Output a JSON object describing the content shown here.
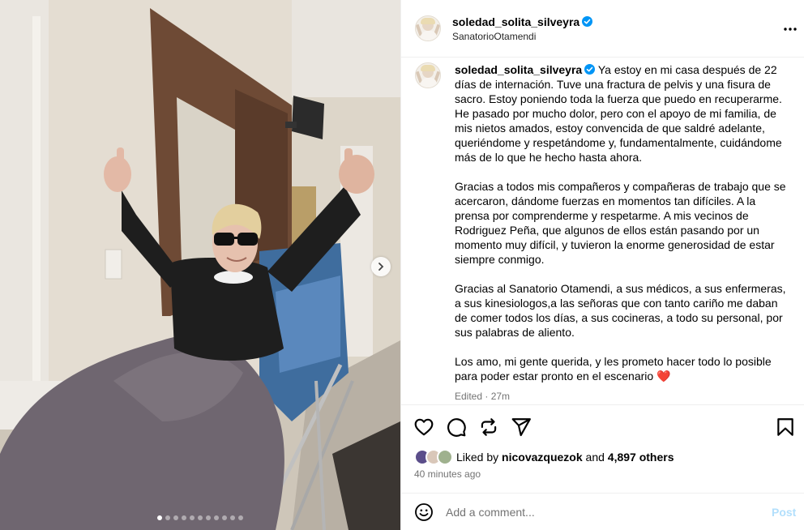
{
  "header": {
    "username": "soledad_solita_silveyra",
    "location": "SanatorioOtamendi",
    "more_icon": "more-horizontal-icon"
  },
  "caption": {
    "username": "soledad_solita_silveyra",
    "paragraphs": [
      "Ya estoy en mi casa después de 22 días de internación. Tuve una fractura de pelvis y una fisura de sacro. Estoy poniendo toda la fuerza que puedo en recuperarme. He pasado por mucho dolor, pero con el apoyo de mi familia, de mis nietos amados, estoy convencida de que saldré adelante, queriéndome y respetándome y, fundamentalmente, cuidándome más de lo que he hecho hasta ahora.",
      "Gracias a todos mis compañeros y compañeras de trabajo que se acercaron, dándome fuerzas en momentos tan difíciles. A la prensa por comprenderme y respetarme. A mis vecinos de Rodriguez Peña, que algunos de ellos están pasando por un momento muy difícil, y tuvieron la enorme generosidad de estar siempre conmigo.",
      "Gracias al Sanatorio Otamendi, a sus médicos, a sus enfermeras, a sus kinesiologos,a las señoras que con tanto cariño me daban de comer todos los días, a sus cocineras, a todo su personal, por sus palabras de aliento.",
      "Los amo, mi gente querida, y les prometo hacer todo lo posible para poder estar pronto en el escenario"
    ],
    "emoji": "❤️",
    "edited": "Edited · 27m"
  },
  "actions": {
    "like_icon": "heart-icon",
    "comment_icon": "comment-icon",
    "share_icon": "repost-icon",
    "send_icon": "send-icon",
    "save_icon": "bookmark-icon"
  },
  "likes": {
    "prefix": "Liked by",
    "user": "nicovazquezok",
    "and": "and",
    "others": "4,897 others"
  },
  "time_ago": "40 minutes ago",
  "comment": {
    "placeholder": "Add a comment...",
    "post_label": "Post"
  },
  "carousel": {
    "dot_count": 11,
    "active_index": 0
  },
  "colors": {
    "verified": "#0095f6",
    "heart": "#ff3040",
    "post_disabled": "#b2dffc",
    "muted_text": "#737373"
  }
}
